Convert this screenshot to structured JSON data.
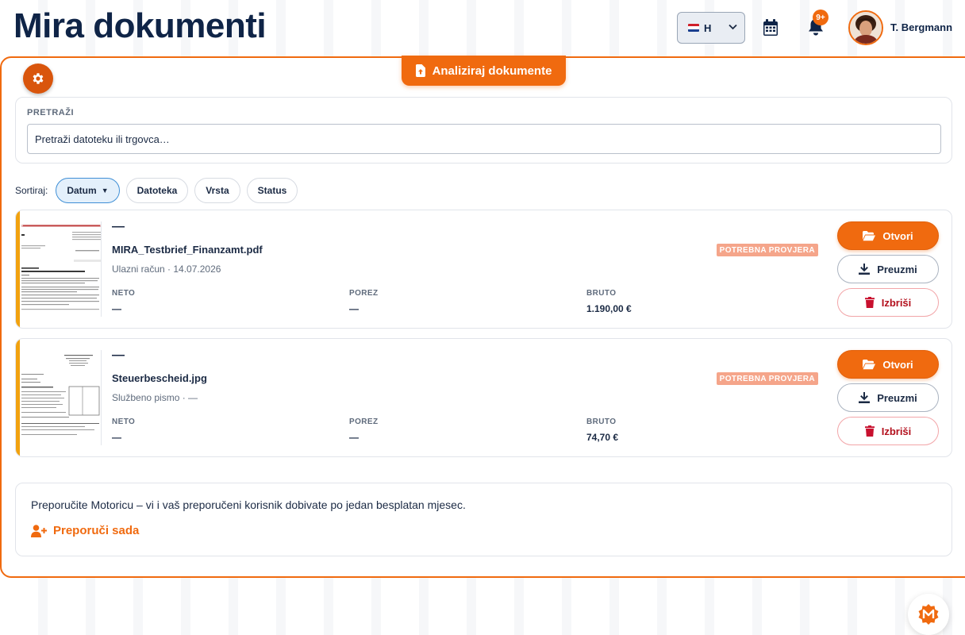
{
  "page": {
    "title": "Mira dokumenti"
  },
  "header": {
    "language": {
      "selected": "H",
      "flag": "croatia-flag-icon"
    },
    "calendar_icon": "calendar-icon",
    "notifications": {
      "icon": "bell-icon",
      "badge": "9+"
    },
    "user": {
      "name": "T. Bergmann",
      "avatar": "user-avatar"
    }
  },
  "toolbar": {
    "settings_icon": "gear-icon",
    "analyze_label": "Analiziraj dokumente",
    "analyze_icon": "file-upload-icon"
  },
  "search": {
    "label": "PRETRAŽI",
    "value": "",
    "placeholder": "Pretraži datoteku ili trgovca…"
  },
  "sort": {
    "label": "Sortiraj:",
    "options": [
      {
        "label": "Datum",
        "active": true,
        "direction": "▼"
      },
      {
        "label": "Datoteka",
        "active": false
      },
      {
        "label": "Vrsta",
        "active": false
      },
      {
        "label": "Status",
        "active": false
      }
    ]
  },
  "documents": [
    {
      "title": "—",
      "file_name": "MIRA_Testbrief_Finanzamt.pdf",
      "meta": "Ulazni račun · 14.07.2026",
      "status": "POTREBNA PROVJERA",
      "neto_label": "NETO",
      "neto": "—",
      "porez_label": "POREZ",
      "porez": "—",
      "bruto_label": "BRUTO",
      "bruto": "1.190,00 €",
      "open_label": "Otvori",
      "download_label": "Preuzmi",
      "delete_label": "Izbriši"
    },
    {
      "title": "—",
      "file_name": "Steuerbescheid.jpg",
      "meta": "Službeno pismo · —",
      "status": "POTREBNA PROVJERA",
      "neto_label": "NETO",
      "neto": "—",
      "porez_label": "POREZ",
      "porez": "—",
      "bruto_label": "BRUTO",
      "bruto": "74,70 €",
      "open_label": "Otvori",
      "download_label": "Preuzmi",
      "delete_label": "Izbriši"
    }
  ],
  "referral": {
    "text": "Preporučite Motoricu – vi i vaš preporučeni korisnik dobivate po jedan besplatan mjesec.",
    "link_label": "Preporuči sada",
    "link_icon": "user-plus-icon"
  },
  "colors": {
    "accent": "#f06a0f",
    "navy": "#0f2447",
    "warning_stripe": "#f1a20f",
    "status_badge": "#f5a58a",
    "danger": "#b3101d"
  }
}
